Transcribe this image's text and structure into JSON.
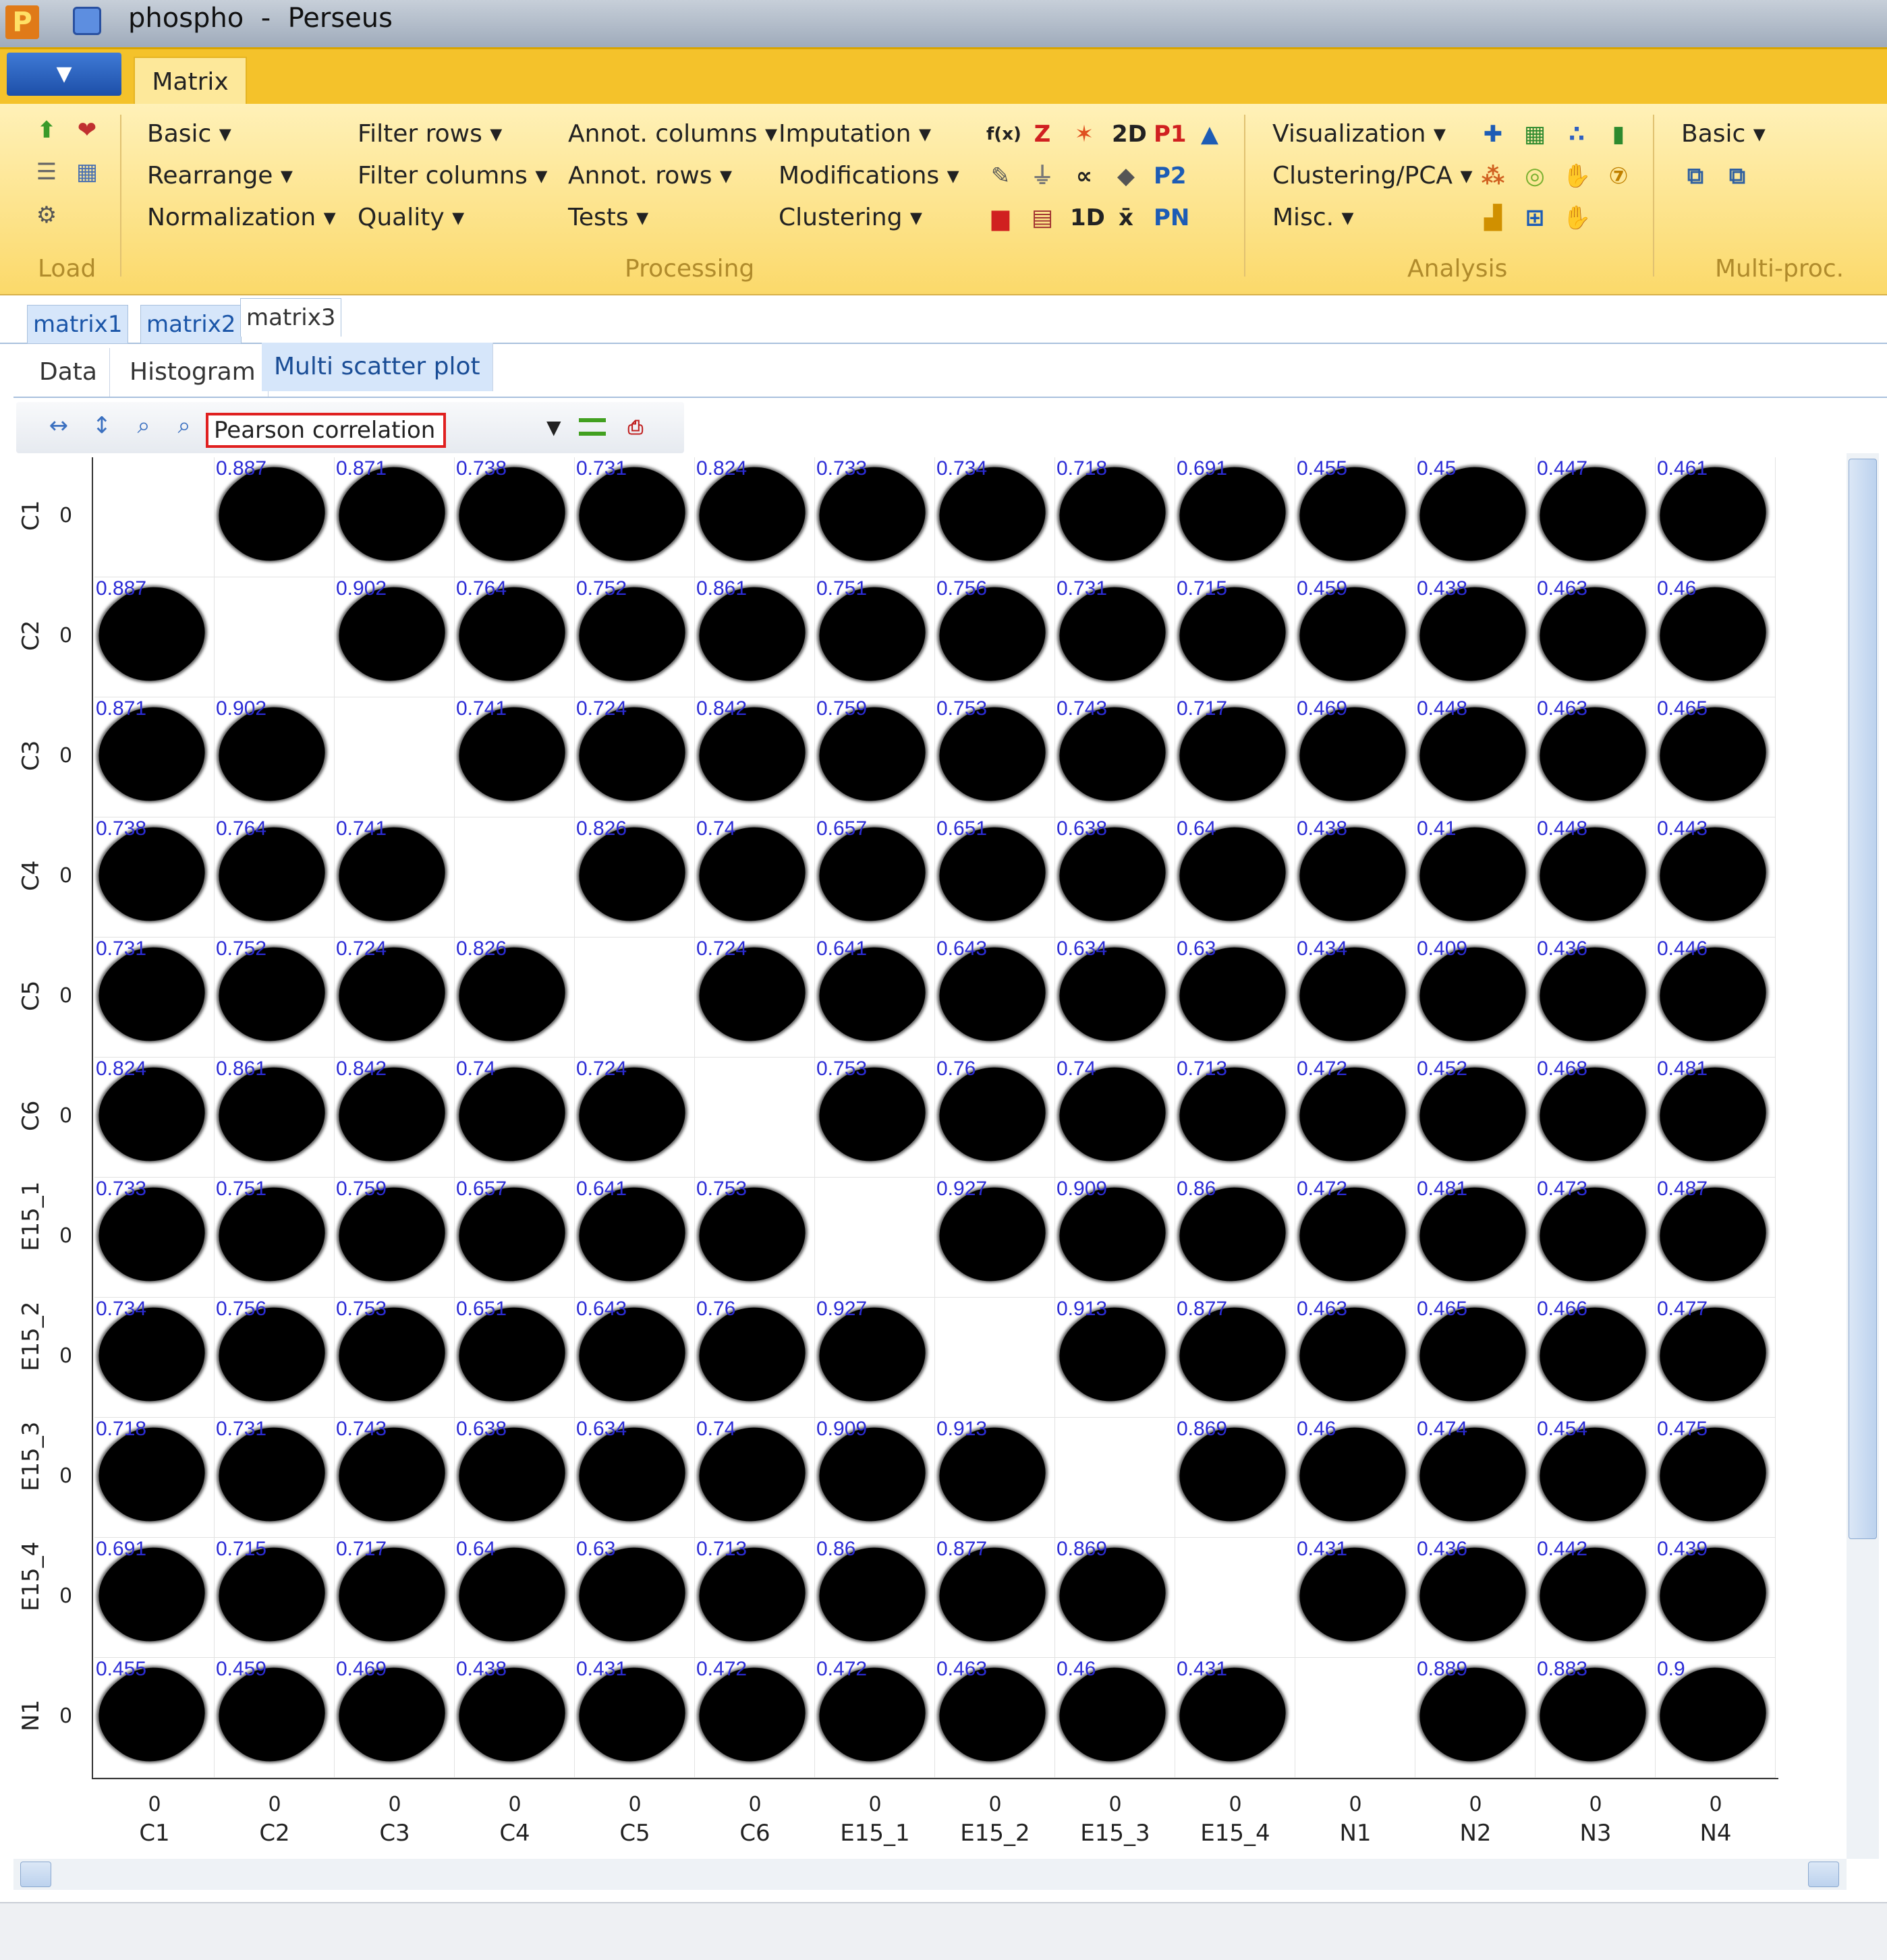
{
  "window": {
    "title": "phospho  -  Perseus"
  },
  "ribbon": {
    "tab": "Matrix",
    "groups": {
      "load": "Load",
      "processing": "Processing",
      "analysis": "Analysis",
      "multiproc": "Multi-proc."
    },
    "menus": {
      "basic": "Basic",
      "rearrange": "Rearrange",
      "normalization": "Normalization",
      "filter_rows": "Filter rows",
      "filter_columns": "Filter columns",
      "quality": "Quality",
      "annot_columns": "Annot. columns",
      "annot_rows": "Annot. rows",
      "tests": "Tests",
      "imputation": "Imputation",
      "modifications": "Modifications",
      "clustering": "Clustering",
      "visualization": "Visualization",
      "clustering_pca": "Clustering/PCA",
      "misc": "Misc.",
      "multiproc_basic": "Basic"
    },
    "icon_text": {
      "fx": "f(x)",
      "z": "Z",
      "2d": "2D",
      "p1": "P1",
      "p2": "P2",
      "1d": "1D",
      "xbar": "x̄",
      "pn": "PN"
    }
  },
  "matrix_tabs": [
    "matrix1",
    "matrix2",
    "matrix3"
  ],
  "view_tabs": [
    "Data",
    "Histogram",
    "Multi scatter plot"
  ],
  "toolbar": {
    "measure": "Pearson correlation"
  },
  "plot": {
    "axis_zero": "0",
    "rows": [
      "C1",
      "C2",
      "C3",
      "C4",
      "C5",
      "C6",
      "E15_1",
      "E15_2",
      "E15_3",
      "E15_4",
      "N1"
    ],
    "columns": [
      "C1",
      "C2",
      "C3",
      "C4",
      "C5",
      "C6",
      "E15_1",
      "E15_2",
      "E15_3",
      "E15_4",
      "N1",
      "N2",
      "N3",
      "N4"
    ],
    "values": [
      [
        "",
        "0.887",
        "0.871",
        "0.738",
        "0.731",
        "0.824",
        "0.733",
        "0.734",
        "0.718",
        "0.691",
        "0.455",
        "0.45",
        "0.447",
        "0.461"
      ],
      [
        "0.887",
        "",
        "0.902",
        "0.764",
        "0.752",
        "0.861",
        "0.751",
        "0.756",
        "0.731",
        "0.715",
        "0.459",
        "0.438",
        "0.463",
        "0.46"
      ],
      [
        "0.871",
        "0.902",
        "",
        "0.741",
        "0.724",
        "0.842",
        "0.759",
        "0.753",
        "0.743",
        "0.717",
        "0.469",
        "0.448",
        "0.463",
        "0.465"
      ],
      [
        "0.738",
        "0.764",
        "0.741",
        "",
        "0.826",
        "0.74",
        "0.657",
        "0.651",
        "0.638",
        "0.64",
        "0.438",
        "0.41",
        "0.448",
        "0.443"
      ],
      [
        "0.731",
        "0.752",
        "0.724",
        "0.826",
        "",
        "0.724",
        "0.641",
        "0.643",
        "0.634",
        "0.63",
        "0.434",
        "0.409",
        "0.436",
        "0.446"
      ],
      [
        "0.824",
        "0.861",
        "0.842",
        "0.74",
        "0.724",
        "",
        "0.753",
        "0.76",
        "0.74",
        "0.713",
        "0.472",
        "0.452",
        "0.468",
        "0.481"
      ],
      [
        "0.733",
        "0.751",
        "0.759",
        "0.657",
        "0.641",
        "0.753",
        "",
        "0.927",
        "0.909",
        "0.86",
        "0.472",
        "0.481",
        "0.473",
        "0.487"
      ],
      [
        "0.734",
        "0.756",
        "0.753",
        "0.651",
        "0.643",
        "0.76",
        "0.927",
        "",
        "0.913",
        "0.877",
        "0.463",
        "0.465",
        "0.466",
        "0.477"
      ],
      [
        "0.718",
        "0.731",
        "0.743",
        "0.638",
        "0.634",
        "0.74",
        "0.909",
        "0.913",
        "",
        "0.869",
        "0.46",
        "0.474",
        "0.454",
        "0.475"
      ],
      [
        "0.691",
        "0.715",
        "0.717",
        "0.64",
        "0.63",
        "0.713",
        "0.86",
        "0.877",
        "0.869",
        "",
        "0.431",
        "0.436",
        "0.442",
        "0.439"
      ],
      [
        "0.455",
        "0.459",
        "0.469",
        "0.438",
        "0.431",
        "0.472",
        "0.472",
        "0.463",
        "0.46",
        "0.431",
        "",
        "0.889",
        "0.883",
        "0.9"
      ]
    ]
  }
}
